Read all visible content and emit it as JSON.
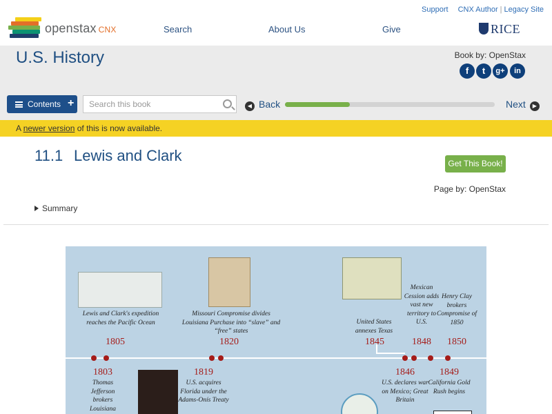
{
  "header": {
    "logo_text": "openstax",
    "logo_sub": "CNX",
    "top_links": [
      "Support",
      "CNX Author",
      "Legacy Site"
    ],
    "nav": [
      "Search",
      "About Us",
      "Give"
    ],
    "partner": "RICE",
    "logo_colors": [
      "#f4d019",
      "#e36f29",
      "#78b04a",
      "#0c9372",
      "#1e3f6b"
    ]
  },
  "book": {
    "title": "U.S. History",
    "by": "Book by: OpenStax",
    "social_icons": [
      "facebook-icon",
      "twitter-icon",
      "google-plus-icon",
      "linkedin-icon"
    ],
    "social_glyphs": [
      "f",
      "t",
      "g+",
      "in"
    ]
  },
  "toolbar": {
    "contents_label": "Contents",
    "search_placeholder": "Search this book",
    "back_label": "Back",
    "next_label": "Next",
    "progress": 0.31
  },
  "notice": {
    "prefix": "A ",
    "link": "newer version",
    "suffix": " of this is now available."
  },
  "section": {
    "number": "11.1",
    "title": "Lewis and Clark",
    "get_book": "Get This Book!",
    "page_by": "Page by: OpenStax",
    "summary": "Summary"
  },
  "timeline": {
    "events": [
      {
        "year": "1805",
        "text": "Lewis and Clark's expedition reaches the Pacific Ocean"
      },
      {
        "year": "1820",
        "text": "Missouri Compromise divides Louisiana Purchase into “slave” and “free” states"
      },
      {
        "year": "1845",
        "text": "United States annexes Texas"
      },
      {
        "year": "1848",
        "text": "Mexican Cession adds vast new territory to U.S."
      },
      {
        "year": "1850",
        "text": "Henry Clay brokers Compromise of 1850"
      },
      {
        "year": "1803",
        "text": "Thomas Jefferson brokers Louisiana"
      },
      {
        "year": "1819",
        "text": "U.S. acquires Florida under the Adams-Onís Treaty"
      },
      {
        "year": "1846",
        "text": "U.S. declares war on Mexico; Great Britain"
      },
      {
        "year": "1849",
        "text": "California Gold Rush begins"
      }
    ]
  }
}
